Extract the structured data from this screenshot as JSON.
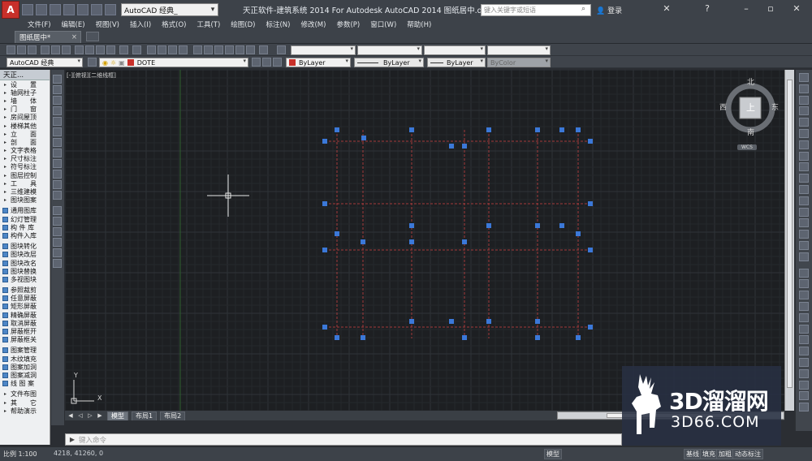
{
  "window": {
    "title": "天正软件-建筑系统 2014  For Autodesk AutoCAD 2014     图纸居中.d...",
    "workspace": "AutoCAD 经典_",
    "app_logo": "A",
    "search_placeholder": "键入关键字或短语",
    "login": "登录"
  },
  "menu": [
    "文件(F)",
    "编辑(E)",
    "视图(V)",
    "插入(I)",
    "格式(O)",
    "工具(T)",
    "绘图(D)",
    "标注(N)",
    "修改(M)",
    "参数(P)",
    "窗口(W)",
    "帮助(H)"
  ],
  "tabs": {
    "document": "图纸居中*",
    "close": "×"
  },
  "toolbar": {
    "workspace2": "AutoCAD 经典",
    "layer": "DOTE",
    "color": "ByLayer",
    "linetype": "ByLayer",
    "lineweight": "ByLayer",
    "plotstyle": "ByColor",
    "accent_red": "#c8302a"
  },
  "side_panel": {
    "title": "天正...",
    "groups": [
      [
        "设　　置",
        "轴网柱子",
        "墙　　体",
        "门　　窗",
        "房间屋顶",
        "楼梯其他",
        "立　　面",
        "剖　　面",
        "文字表格",
        "尺寸标注",
        "符号标注",
        "图层控制",
        "工　　具",
        "三维建模",
        "图块图案"
      ],
      [
        "通用图库",
        "幻灯管理",
        "构 件 库",
        "构件入库"
      ],
      [
        "图块转化",
        "图块改层",
        "图块改名",
        "图块替换",
        "多视图块"
      ],
      [
        "参照裁剪",
        "任意屏蔽",
        "矩形屏蔽",
        "精确屏蔽",
        "取消屏蔽",
        "屏蔽框开",
        "屏蔽框关"
      ],
      [
        "图案管理",
        "木纹填充",
        "图案加洞",
        "图案减洞",
        "线 图 案"
      ],
      [
        "文件布图",
        "其　　它",
        "帮助演示"
      ]
    ]
  },
  "canvas": {
    "viewport_label": "[-][俯视][二维线框]",
    "compass": {
      "north": "北",
      "south": "南",
      "east": "东",
      "west": "西",
      "top": "上",
      "wcs": "WCS"
    },
    "ucs": {
      "x": "X",
      "y": "Y"
    },
    "grip_color": "#3b78d8",
    "axis_color": "#a33a3a"
  },
  "layout_tabs": [
    "模型",
    "布局1",
    "布局2"
  ],
  "command": {
    "prompt": "▶",
    "placeholder": "键入命令"
  },
  "status": {
    "scale": "比例 1:100",
    "coords": "4218, 41260, 0",
    "buttons": [
      "模型",
      "基线",
      "填充",
      "加粗",
      "动态标注"
    ]
  },
  "watermark": {
    "main": "3D溜溜网",
    "sub": "3D66.COM"
  }
}
